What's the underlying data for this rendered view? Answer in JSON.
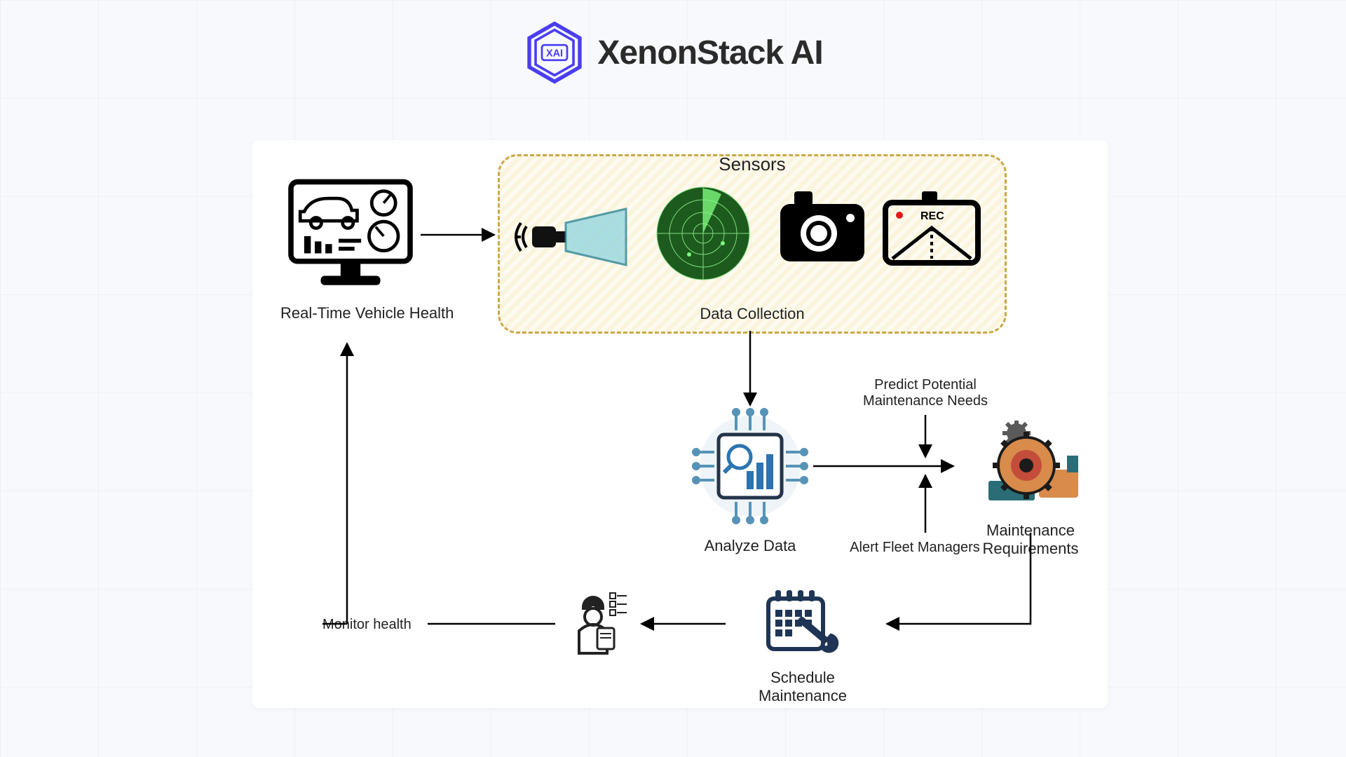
{
  "header": {
    "brand_text": "XenonStack AI",
    "logo_letters": "XAI"
  },
  "diagram": {
    "sensors_box_title": "Sensors",
    "nodes": {
      "vehicle_health": "Real-Time Vehicle Health",
      "data_collection": "Data Collection",
      "analyze_data": "Analyze Data",
      "maintenance_requirements": "Maintenance Requirements",
      "schedule_maintenance": "Schedule Maintenance",
      "monitor_health": "Monitor health"
    },
    "edges": {
      "predict_needs": "Predict Potential\nMaintenance Needs",
      "alert_managers": "Alert Fleet Managers"
    },
    "sensor_icons": {
      "camera_sensor": "camera-sensor",
      "radar": "radar",
      "dashcam": "dashcam",
      "rec_label": "REC"
    }
  }
}
